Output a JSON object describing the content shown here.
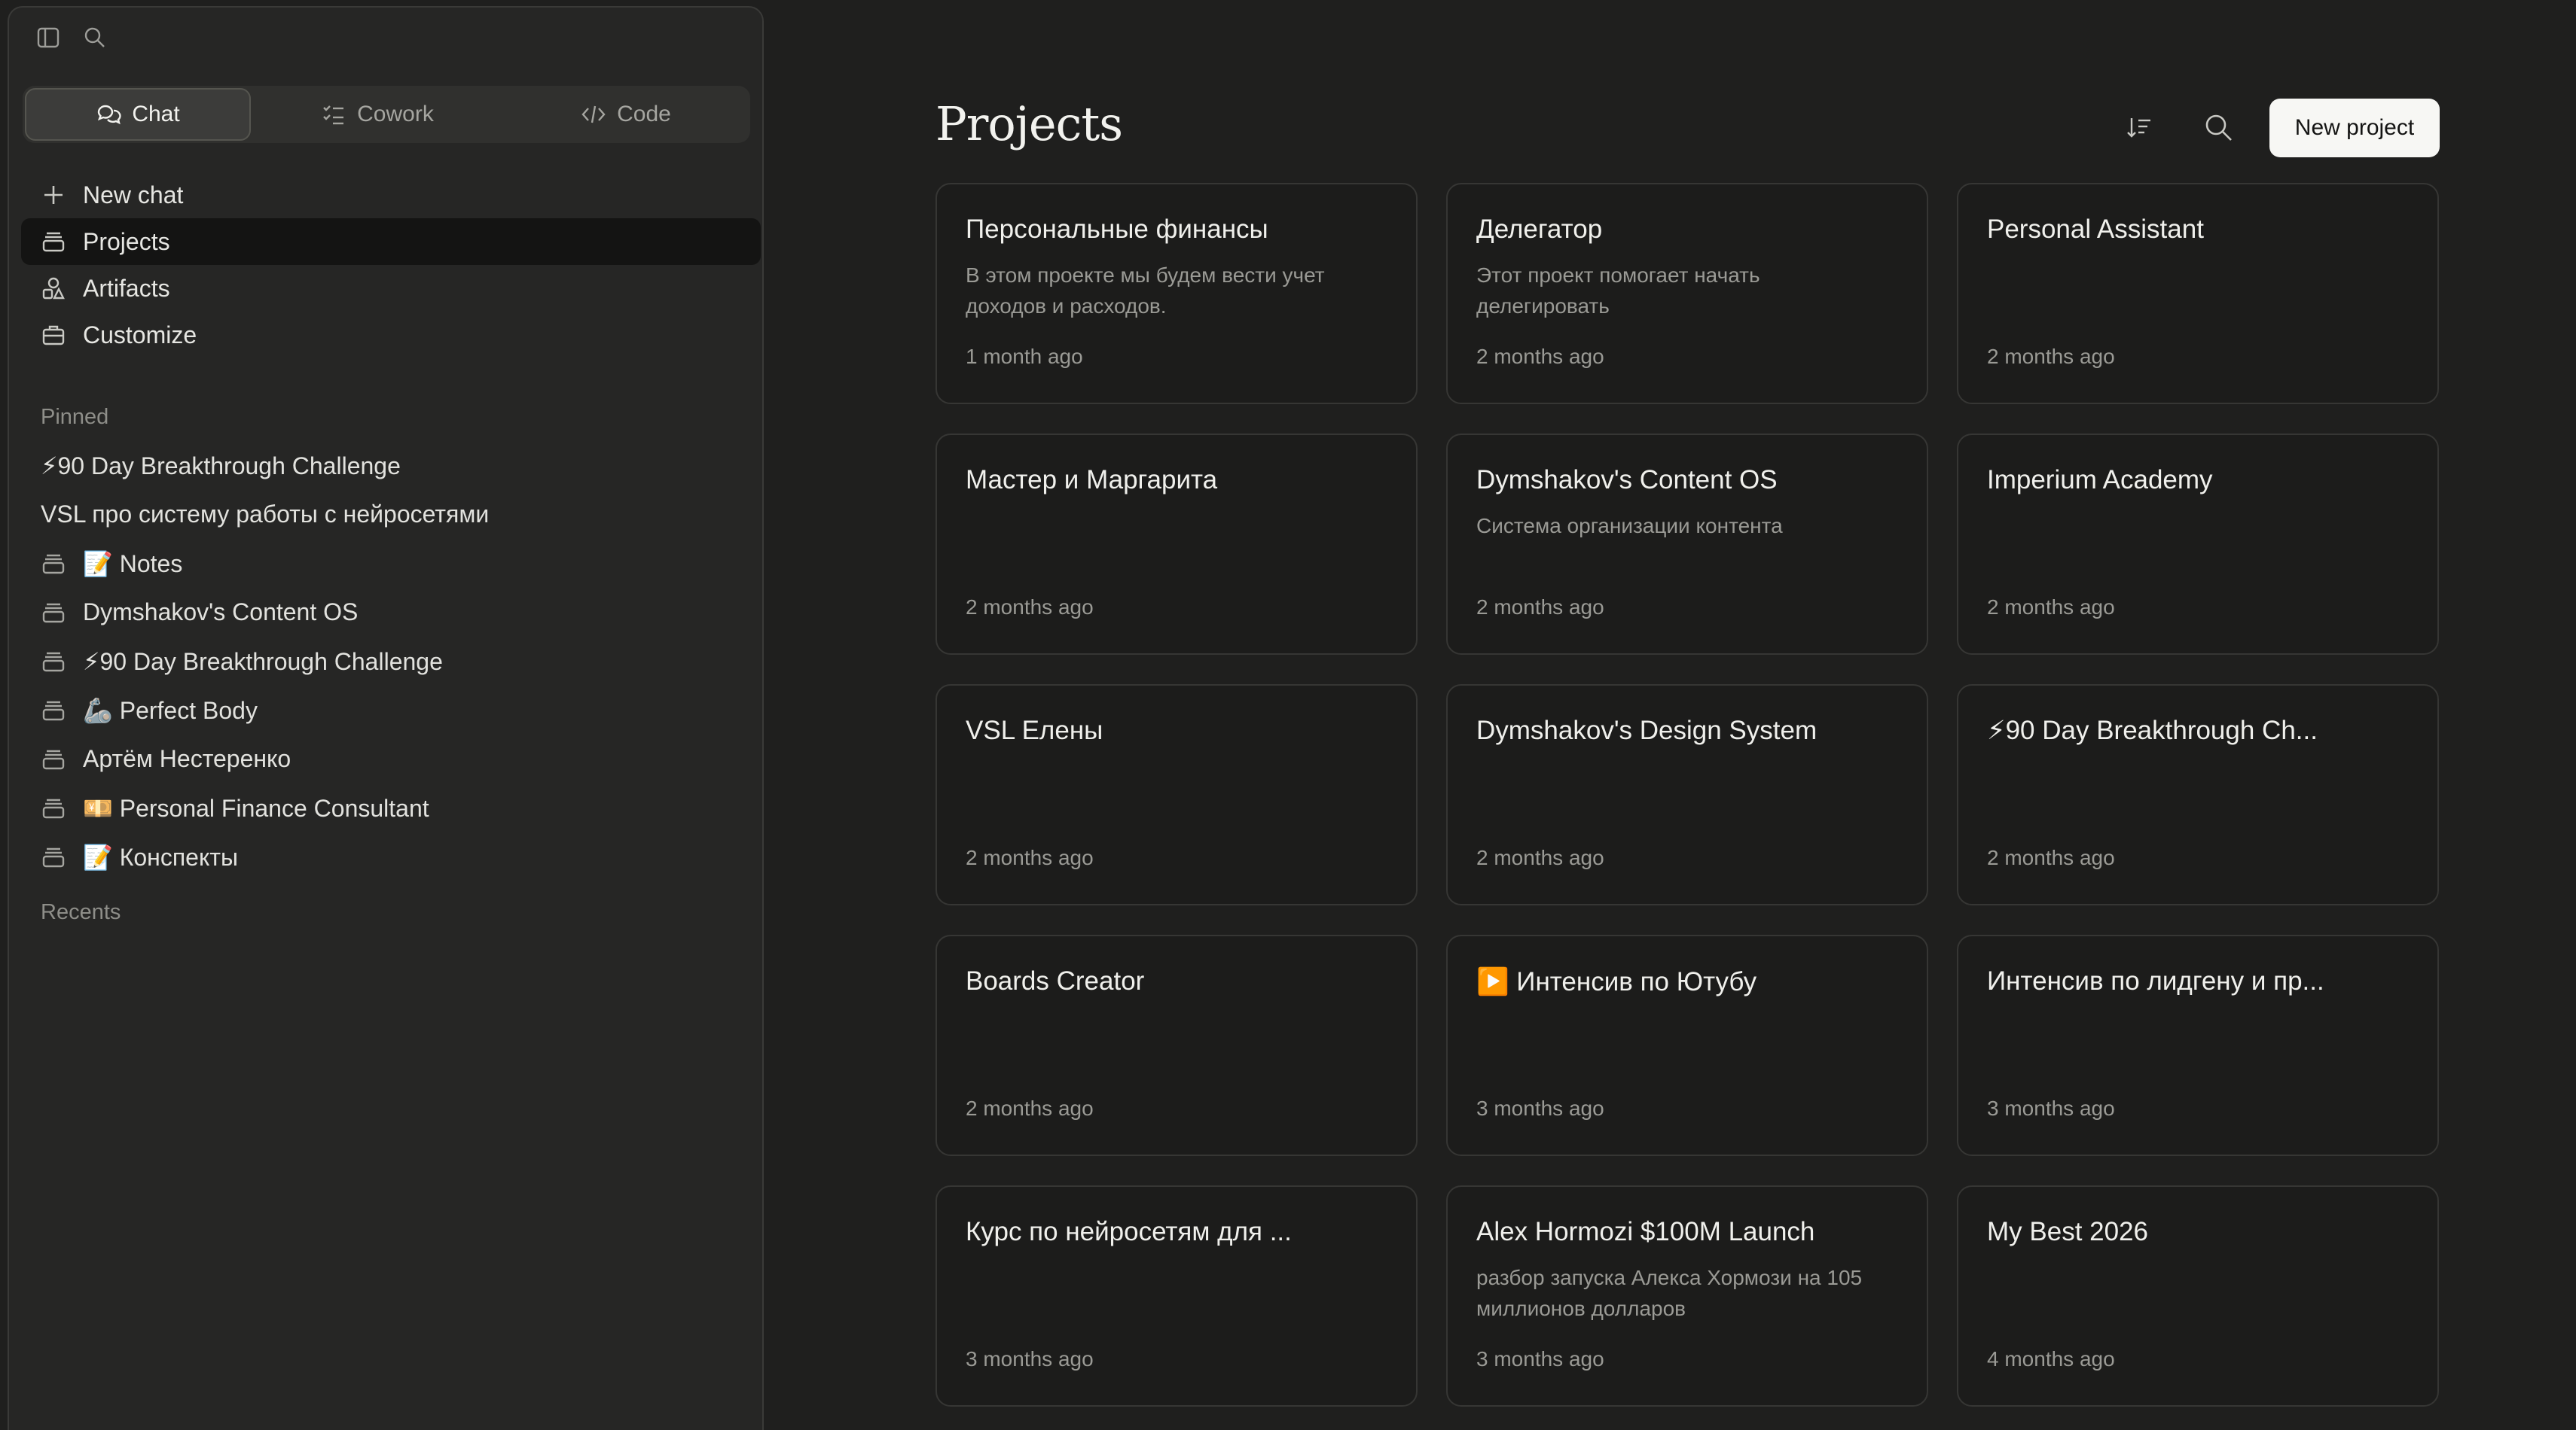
{
  "sidebar": {
    "top_icons": [
      "sidebar-toggle-icon",
      "search-icon"
    ],
    "modes": [
      {
        "label": "Chat",
        "icon": "chat-bubbles-icon",
        "active": true
      },
      {
        "label": "Cowork",
        "icon": "checklist-icon",
        "active": false
      },
      {
        "label": "Code",
        "icon": "code-brackets-icon",
        "active": false
      }
    ],
    "nav": [
      {
        "label": "New chat",
        "icon": "plus-icon"
      },
      {
        "label": "Projects",
        "icon": "folder-stack-icon",
        "active": true
      },
      {
        "label": "Artifacts",
        "icon": "shapes-icon"
      },
      {
        "label": "Customize",
        "icon": "briefcase-icon"
      }
    ],
    "pinned_label": "Pinned",
    "pinned": [
      {
        "label": "⚡90 Day Breakthrough Challenge",
        "icon": ""
      },
      {
        "label": "VSL про систему работы с нейросетями",
        "icon": ""
      },
      {
        "label": "📝 Notes",
        "icon": "folder-stack-icon"
      },
      {
        "label": "Dymshakov's Content OS",
        "icon": "folder-stack-icon"
      },
      {
        "label": "⚡90 Day Breakthrough Challenge",
        "icon": "folder-stack-icon"
      },
      {
        "label": "🦾 Perfect Body",
        "icon": "folder-stack-icon"
      },
      {
        "label": "Артём Нестеренко",
        "icon": "folder-stack-icon"
      },
      {
        "label": "💴 Personal Finance Consultant",
        "icon": "folder-stack-icon"
      },
      {
        "label": "📝 Конспекты",
        "icon": "folder-stack-icon"
      }
    ],
    "recents_label": "Recents"
  },
  "main": {
    "title": "Projects",
    "sort_icon": "sort-icon",
    "search_icon": "search-icon",
    "new_project_label": "New project",
    "projects": [
      {
        "title": "Персональные финансы",
        "description": "В этом проекте мы будем вести учет доходов и расходов.",
        "updated": "1 month ago"
      },
      {
        "title": "Делегатор",
        "description": "Этот проект помогает начать делегировать",
        "updated": "2 months ago"
      },
      {
        "title": "Personal Assistant",
        "description": "",
        "updated": "2 months ago"
      },
      {
        "title": "Мастер и Маргарита",
        "description": "",
        "updated": "2 months ago"
      },
      {
        "title": "Dymshakov's Content OS",
        "description": "Система организации контента",
        "updated": "2 months ago"
      },
      {
        "title": "Imperium Academy",
        "description": "",
        "updated": "2 months ago"
      },
      {
        "title": "VSL Елены",
        "description": "",
        "updated": "2 months ago"
      },
      {
        "title": "Dymshakov's Design System",
        "description": "",
        "updated": "2 months ago"
      },
      {
        "title": "⚡90 Day Breakthrough Ch...",
        "description": "",
        "updated": "2 months ago"
      },
      {
        "title": "Boards Creator",
        "description": "",
        "updated": "2 months ago"
      },
      {
        "title": "▶️ Интенсив по Ютубу",
        "description": "",
        "updated": "3 months ago"
      },
      {
        "title": "Интенсив по лидгену и пр...",
        "description": "",
        "updated": "3 months ago"
      },
      {
        "title": "Курс по нейросетям для ...",
        "description": "",
        "updated": "3 months ago"
      },
      {
        "title": "Alex Hormozi $100M Launch",
        "description": "разбор запуска Алекса Хормози на 105 миллионов долларов",
        "updated": "3 months ago"
      },
      {
        "title": "My Best 2026",
        "description": "",
        "updated": "4 months ago"
      }
    ]
  }
}
